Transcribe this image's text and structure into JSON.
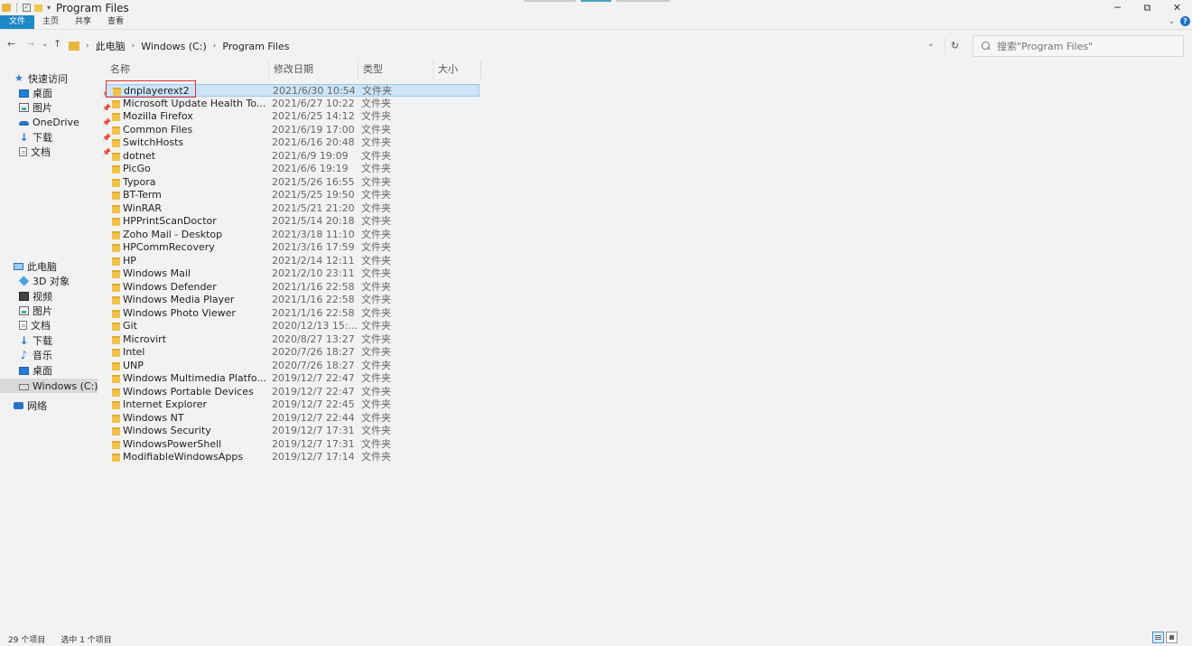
{
  "window": {
    "title": "Program Files",
    "minimize": "─",
    "maximize": "⧉",
    "close": "✕"
  },
  "ribbon": {
    "tabs": [
      "文件",
      "主页",
      "共享",
      "查看"
    ],
    "help": "?"
  },
  "address": {
    "crumbs": [
      "此电脑",
      "Windows (C:)",
      "Program Files"
    ],
    "back": "←",
    "forward": "→",
    "up": "↑",
    "recent": "⌄",
    "dropdown": "⌄",
    "refresh": "↻",
    "separator": "›"
  },
  "search": {
    "placeholder": "搜索\"Program Files\""
  },
  "sidebar": {
    "quick_access": "快速访问",
    "quick_items": [
      {
        "label": "桌面",
        "icon": "desktop-icon",
        "pinned": true
      },
      {
        "label": "图片",
        "icon": "pictures-icon",
        "pinned": true
      },
      {
        "label": "OneDrive",
        "icon": "onedrive-icon",
        "pinned": true
      },
      {
        "label": "下载",
        "icon": "download-icon",
        "pinned": true
      },
      {
        "label": "文档",
        "icon": "documents-icon",
        "pinned": true
      }
    ],
    "this_pc": "此电脑",
    "pc_items": [
      {
        "label": "3D 对象",
        "icon": "3d-objects-icon"
      },
      {
        "label": "视频",
        "icon": "videos-icon"
      },
      {
        "label": "图片",
        "icon": "pictures-icon"
      },
      {
        "label": "文档",
        "icon": "documents-icon"
      },
      {
        "label": "下载",
        "icon": "download-icon"
      },
      {
        "label": "音乐",
        "icon": "music-icon"
      },
      {
        "label": "桌面",
        "icon": "desktop-icon"
      },
      {
        "label": "Windows (C:)",
        "icon": "drive-icon",
        "selected": true
      }
    ],
    "network": "网络"
  },
  "columns": {
    "name": "名称",
    "date": "修改日期",
    "type": "类型",
    "size": "大小"
  },
  "files": [
    {
      "name": "dnplayerext2",
      "date": "2021/6/30 10:54",
      "type": "文件夹",
      "selected": true
    },
    {
      "name": "Microsoft Update Health To...",
      "date": "2021/6/27 10:22",
      "type": "文件夹"
    },
    {
      "name": "Mozilla Firefox",
      "date": "2021/6/25 14:12",
      "type": "文件夹"
    },
    {
      "name": "Common Files",
      "date": "2021/6/19 17:00",
      "type": "文件夹"
    },
    {
      "name": "SwitchHosts",
      "date": "2021/6/16 20:48",
      "type": "文件夹"
    },
    {
      "name": "dotnet",
      "date": "2021/6/9 19:09",
      "type": "文件夹"
    },
    {
      "name": "PicGo",
      "date": "2021/6/6 19:19",
      "type": "文件夹"
    },
    {
      "name": "Typora",
      "date": "2021/5/26 16:55",
      "type": "文件夹"
    },
    {
      "name": "BT-Term",
      "date": "2021/5/25 19:50",
      "type": "文件夹"
    },
    {
      "name": "WinRAR",
      "date": "2021/5/21 21:20",
      "type": "文件夹"
    },
    {
      "name": "HPPrintScanDoctor",
      "date": "2021/5/14 20:18",
      "type": "文件夹"
    },
    {
      "name": "Zoho Mail - Desktop",
      "date": "2021/3/18 11:10",
      "type": "文件夹"
    },
    {
      "name": "HPCommRecovery",
      "date": "2021/3/16 17:59",
      "type": "文件夹"
    },
    {
      "name": "HP",
      "date": "2021/2/14 12:11",
      "type": "文件夹"
    },
    {
      "name": "Windows Mail",
      "date": "2021/2/10 23:11",
      "type": "文件夹"
    },
    {
      "name": "Windows Defender",
      "date": "2021/1/16 22:58",
      "type": "文件夹"
    },
    {
      "name": "Windows Media Player",
      "date": "2021/1/16 22:58",
      "type": "文件夹"
    },
    {
      "name": "Windows Photo Viewer",
      "date": "2021/1/16 22:58",
      "type": "文件夹"
    },
    {
      "name": "Git",
      "date": "2020/12/13 15:...",
      "type": "文件夹"
    },
    {
      "name": "Microvirt",
      "date": "2020/8/27 13:27",
      "type": "文件夹"
    },
    {
      "name": "Intel",
      "date": "2020/7/26 18:27",
      "type": "文件夹"
    },
    {
      "name": "UNP",
      "date": "2020/7/26 18:27",
      "type": "文件夹"
    },
    {
      "name": "Windows Multimedia Platfo...",
      "date": "2019/12/7 22:47",
      "type": "文件夹"
    },
    {
      "name": "Windows Portable Devices",
      "date": "2019/12/7 22:47",
      "type": "文件夹"
    },
    {
      "name": "Internet Explorer",
      "date": "2019/12/7 22:45",
      "type": "文件夹"
    },
    {
      "name": "Windows NT",
      "date": "2019/12/7 22:44",
      "type": "文件夹"
    },
    {
      "name": "Windows Security",
      "date": "2019/12/7 17:31",
      "type": "文件夹"
    },
    {
      "name": "WindowsPowerShell",
      "date": "2019/12/7 17:31",
      "type": "文件夹"
    },
    {
      "name": "ModifiableWindowsApps",
      "date": "2019/12/7 17:14",
      "type": "文件夹"
    }
  ],
  "status": {
    "count": "29 个项目",
    "selected": "选中 1 个项目"
  },
  "colors": {
    "file_tab": "#1e89c7",
    "selection": "#cce4f7",
    "highlight_box": "#e03030",
    "folder": "#f0c24a"
  }
}
